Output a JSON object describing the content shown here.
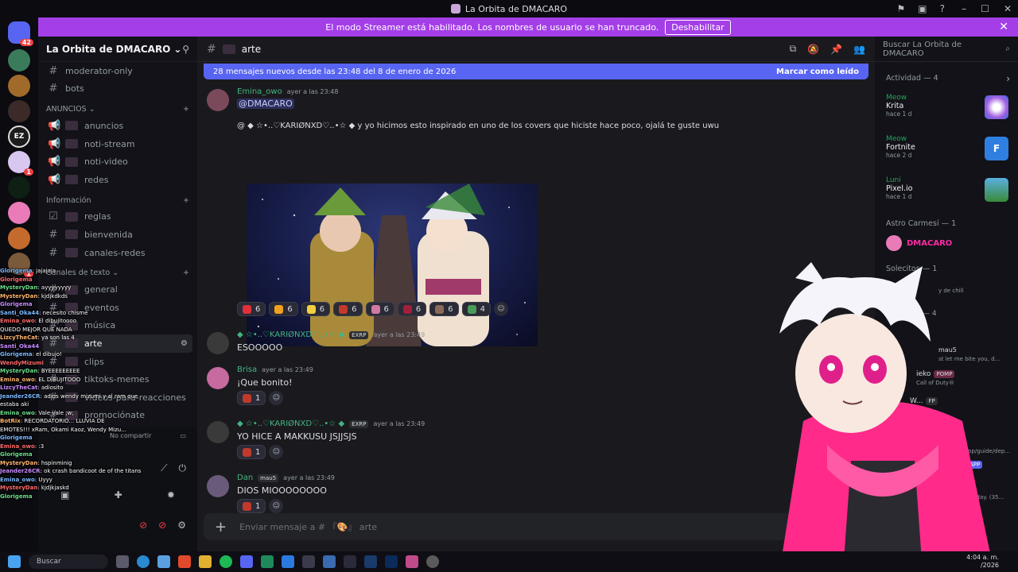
{
  "window": {
    "title": "La Orbita de DMACARO"
  },
  "banner": {
    "text": "El modo Streamer está habilitado. Los nombres de usuario se han truncado.",
    "button": "Deshabilitar"
  },
  "servers": {
    "home_badge": "42",
    "badge_1": "1",
    "badge_2": "1",
    "letters": "EZ"
  },
  "sidebar": {
    "server_name": "La Orbita de DMACARO",
    "top_items": [
      {
        "label": "moderator-only"
      },
      {
        "label": "bots"
      }
    ],
    "cat_anuncios": "ANUNCIOS",
    "anuncios": [
      {
        "label": "anuncios"
      },
      {
        "label": "noti-stream"
      },
      {
        "label": "noti-video"
      },
      {
        "label": "redes"
      }
    ],
    "cat_info": "Información",
    "info": [
      {
        "label": "reglas"
      },
      {
        "label": "bienvenida"
      },
      {
        "label": "canales-redes"
      }
    ],
    "cat_texto": "Canales de texto",
    "texto": [
      {
        "label": "general"
      },
      {
        "label": "eventos"
      },
      {
        "label": "música"
      },
      {
        "label": "arte"
      },
      {
        "label": "clips"
      },
      {
        "label": "tiktoks-memes"
      },
      {
        "label": "videos-para-reacciones"
      },
      {
        "label": "promociónate"
      }
    ],
    "no_share": "No compartir"
  },
  "overlay_chat": [
    {
      "name": "Glorigema",
      "text": ": jajajaja"
    },
    {
      "name": "Glorigema",
      "text": ""
    },
    {
      "name": "MysteryDan",
      "text": ": ayyyyyyyy"
    },
    {
      "name": "MysteryDan",
      "text": ": kjdjkdkds"
    },
    {
      "name": "Glorigema",
      "text": ""
    },
    {
      "name": "Santi_Oka44",
      "text": ": necesito chisme"
    },
    {
      "name": "Emina_owo",
      "text": ": El dibujitoooo"
    },
    {
      "name": "",
      "text": "QUEDO MEJOR QUE NADA"
    },
    {
      "name": "LizcyTheCat",
      "text": ": ya son las 4"
    },
    {
      "name": "Santi_Oka44",
      "text": ""
    },
    {
      "name": "Glorigema",
      "text": ": el dibujo!"
    },
    {
      "name": "WendyMizumi",
      "text": ""
    },
    {
      "name": "MysteryDan",
      "text": ": BYEEEEEEEEE"
    },
    {
      "name": "Emina_owo",
      "text": ": EL DIBUJITOOO"
    },
    {
      "name": "LizcyTheCat",
      "text": ": adiosito"
    },
    {
      "name": "Jeander26CR",
      "text": ": adios wendy mizumi y al ram que"
    },
    {
      "name": "",
      "text": "estaba aki"
    },
    {
      "name": "Emina_owo",
      "text": ": Vale vale ;w;"
    },
    {
      "name": "BotRix",
      "text": ": RECORDATORIO... LLUVIA DE"
    },
    {
      "name": "",
      "text": "EMOTES!!! xRam, Okami Kaoz, Wendy Mizu..."
    },
    {
      "name": "Glorigema",
      "text": ""
    },
    {
      "name": "Emina_owo",
      "text": ": :3"
    },
    {
      "name": "Glorigema",
      "text": ""
    },
    {
      "name": "MysteryDan",
      "text": ": hspinminig"
    },
    {
      "name": "Jeander26CR",
      "text": ": ok crash bandicoot de of the titans"
    },
    {
      "name": "Emina_owo",
      "text": ": Uyyy"
    },
    {
      "name": "MysteryDan",
      "text": ": kjdjkjaskd"
    },
    {
      "name": "Glorigema",
      "text": ""
    }
  ],
  "chat": {
    "channel": "arte",
    "new_messages": "28 mensajes nuevos desde las 23:48 del 8 de enero de 2026",
    "mark_read": "Marcar como leído",
    "search_placeholder": "Buscar La Orbita de DMACARO",
    "composer_placeholder": "Enviar mensaje a # 『🎨』 arte",
    "messages": [
      {
        "author": "Emina_owo",
        "time": "ayer a las 23:48",
        "text": "@DMACARO",
        "text2": "@ ◆ ☆•..♡KARIØNXD♡..•☆ ◆  y yo hicimos esto inspirado en uno de los covers que hiciste hace poco, ojalá te guste uwu",
        "color": "#e87ba0"
      },
      {
        "author": "◆ ☆•..♡KARIØNXD♡..•☆ ◆",
        "tag": "EXRP",
        "time": "ayer a las 23:49",
        "text": "ESOOOOO",
        "color": "#43b581"
      },
      {
        "author": "Brisa",
        "time": "ayer a las 23:49",
        "text": "¡Que bonito!",
        "color": "#43b581"
      },
      {
        "author": "◆ ☆•..♡KARIØNXD♡..•☆ ◆",
        "tag": "EXRP",
        "time": "ayer a las 23:49",
        "text": "YO HICE A MAKKUSU JSJJSJS",
        "color": "#43b581"
      },
      {
        "author": "Dan",
        "tag": "mau5",
        "time": "ayer a las 23:49",
        "text": "DIOS MIOOOOOOOO",
        "color": "#43b581"
      }
    ],
    "reactions": [
      "6",
      "6",
      "6",
      "6",
      "6",
      "6",
      "6",
      "4"
    ],
    "single_count": "1"
  },
  "right": {
    "activity_title": "Actividad — 4",
    "activities": [
      {
        "user": "Meow",
        "game": "Krita",
        "since": "hace 1 d"
      },
      {
        "user": "Meow",
        "game": "Fortnite",
        "since": "hace 2 d"
      },
      {
        "user": "Luni",
        "game": "Pixel.io",
        "since": "hace 1 d"
      }
    ],
    "group1": "Astro Carmesí — 1",
    "group1_user": "DMACARO",
    "group2": "Solecitos — 1",
    "group2_sub": "y de chill",
    "group3_count": "— 4",
    "people": [
      {
        "name": "mau5",
        "sub": "st let me bite you, d..."
      },
      {
        "name": "ieko",
        "sub": "Call of Duty®",
        "tag": "POMP"
      },
      {
        "name": "W...",
        "tag": "FP"
      },
      {
        "name": "obot",
        "sub": "ast: discohook.app/guide/dep...",
        "tag": "APP"
      },
      {
        "name": "ie Music (2)",
        "tag": "APP"
      },
      {
        "name": "",
        "sub": "tifications today. (35...",
        "tag": "APP"
      },
      {
        "name": "",
        "tag": "APP"
      },
      {
        "name": "",
        "tag": "APP"
      }
    ]
  },
  "taskbar": {
    "search": "Buscar",
    "time": "4:04 a. m.",
    "date": "/2026"
  },
  "colors": {
    "accent": "#5865f2",
    "banner": "#a43fe8",
    "streamer_pink": "#ff2aa5"
  }
}
